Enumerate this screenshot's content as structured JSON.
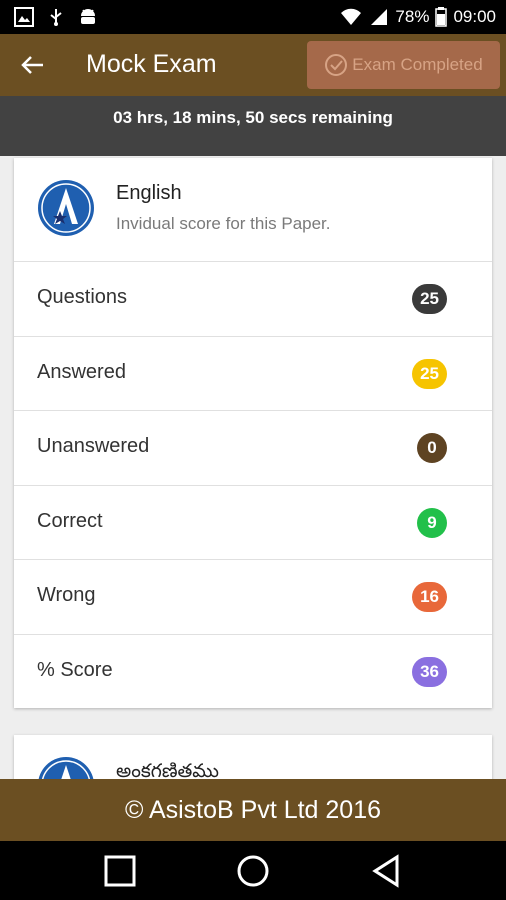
{
  "status_bar": {
    "battery": "78%",
    "time": "09:00"
  },
  "header": {
    "title": "Mock Exam",
    "exam_button_label": "Exam Completed"
  },
  "timer": {
    "text": "03 hrs, 18 mins, 50 secs remaining"
  },
  "paper1": {
    "title": "English",
    "subtitle": "Invidual score for this Paper.",
    "rows": [
      {
        "label": "Questions",
        "value": "25",
        "color": "#3a3a3a"
      },
      {
        "label": "Answered",
        "value": "25",
        "color": "#f6c400"
      },
      {
        "label": "Unanswered",
        "value": "0",
        "color": "#5e4322"
      },
      {
        "label": "Correct",
        "value": "9",
        "color": "#22c04a"
      },
      {
        "label": "Wrong",
        "value": "16",
        "color": "#e8683a"
      },
      {
        "label": "% Score",
        "value": "36",
        "color": "#8a6fe0"
      }
    ]
  },
  "paper2": {
    "title": "అంకగణితము"
  },
  "footer": {
    "text": "© AsistoB Pvt Ltd 2016"
  },
  "colors": {
    "brand": "#6b4f22",
    "timer_bg": "#424242"
  }
}
